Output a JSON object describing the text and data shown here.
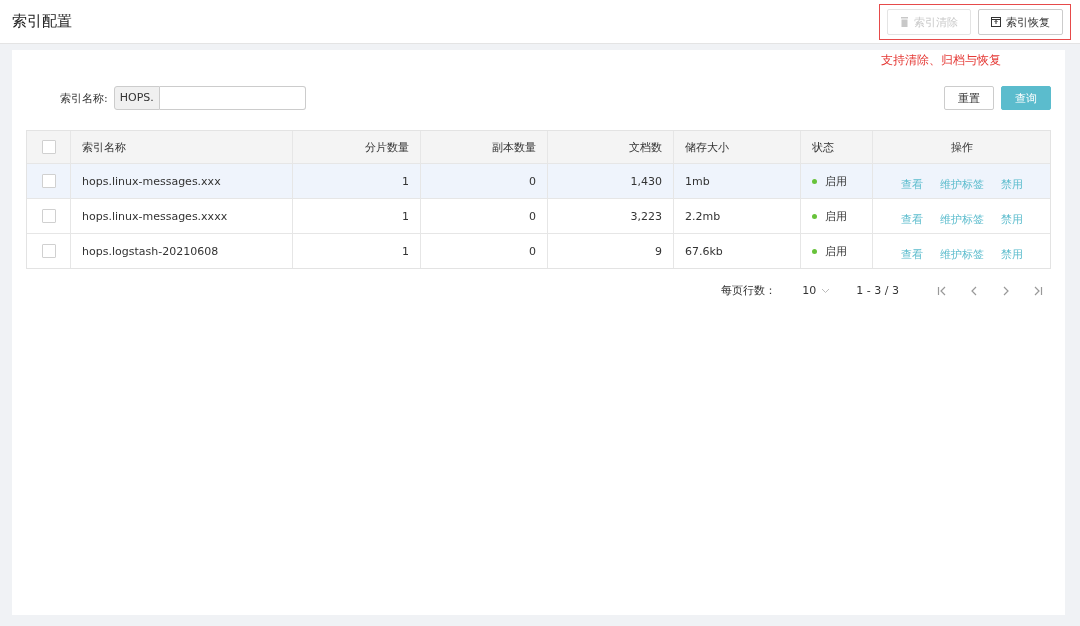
{
  "page_title": "索引配置",
  "toolbar": [
    {
      "kind": "delete",
      "label": "索引清除",
      "disabled": true
    },
    {
      "kind": "restore",
      "label": "索引恢复",
      "disabled": false
    }
  ],
  "annotation": "支持清除、归档与恢复",
  "filter": {
    "label": "索引名称:",
    "prefix": "HOPS."
  },
  "filter_buttons": [
    {
      "kind": "plain",
      "label": "重置"
    },
    {
      "kind": "primary",
      "label": "查询"
    }
  ],
  "table": {
    "columns": [
      "索引名称",
      "分片数量",
      "副本数量",
      "文档数",
      "储存大小",
      "状态",
      "操作"
    ],
    "header_checked": false,
    "rows": [
      {
        "selected": true,
        "checked": false,
        "cells": [
          "hops.linux-messages.xxx",
          "1",
          "0",
          "1,430",
          "1mb"
        ],
        "status": "启用",
        "color": "#67c23a",
        "actions": [
          "查看",
          "维护标签",
          "禁用"
        ]
      },
      {
        "selected": false,
        "checked": false,
        "cells": [
          "hops.linux-messages.xxxx",
          "1",
          "0",
          "3,223",
          "2.2mb"
        ],
        "status": "启用",
        "color": "#67c23a",
        "actions": [
          "查看",
          "维护标签",
          "禁用"
        ]
      },
      {
        "selected": false,
        "checked": false,
        "cells": [
          "hops.logstash-20210608",
          "1",
          "0",
          "9",
          "67.6kb"
        ],
        "status": "启用",
        "color": "#67c23a",
        "actions": [
          "查看",
          "维护标签",
          "禁用"
        ]
      }
    ]
  },
  "pagination": {
    "rows_label": "每页行数：",
    "page_size": "10",
    "range": "1 - 3 / 3"
  }
}
